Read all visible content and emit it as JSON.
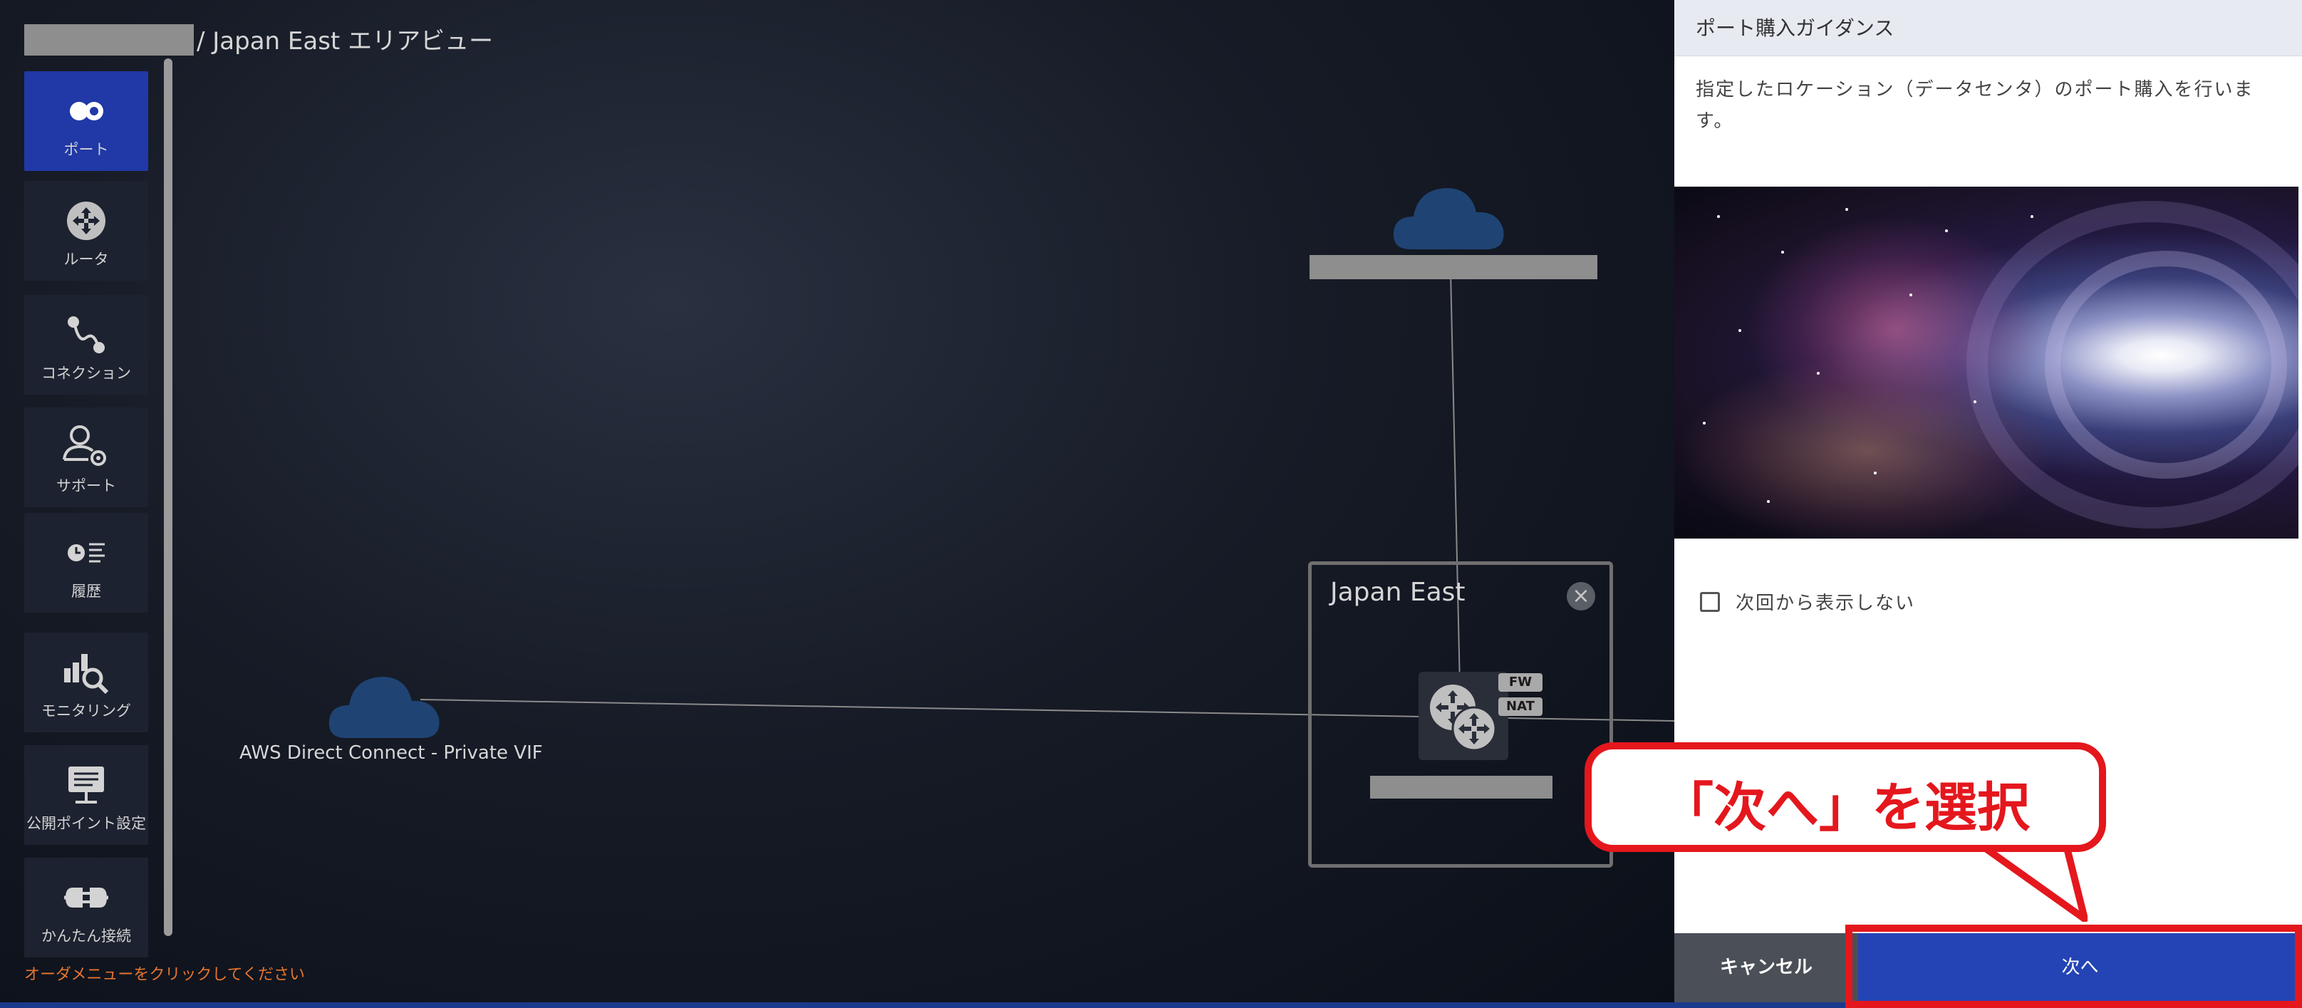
{
  "breadcrumb": {
    "area_label": "/ Japan East エリアビュー"
  },
  "sidebar": {
    "items": [
      {
        "label": "ポート",
        "icon": "port-icon",
        "active": true
      },
      {
        "label": "ルータ",
        "icon": "router-icon",
        "active": false
      },
      {
        "label": "コネクション",
        "icon": "connection-icon",
        "active": false
      },
      {
        "label": "サポート",
        "icon": "support-icon",
        "active": false
      },
      {
        "label": "履歴",
        "icon": "history-icon",
        "active": false
      },
      {
        "label": "モニタリング",
        "icon": "monitoring-icon",
        "active": false
      },
      {
        "label": "公開ポイント設定",
        "icon": "public-point-icon",
        "active": false
      },
      {
        "label": "かんたん接続",
        "icon": "easy-connect-icon",
        "active": false
      }
    ]
  },
  "status": {
    "hint": "オーダメニューをクリックしてください"
  },
  "canvas": {
    "aws_label": "AWS Direct Connect - Private VIF",
    "region_title": "Japan East",
    "close_symbol": "×",
    "tag_fw": "FW",
    "tag_nat": "NAT"
  },
  "panel": {
    "title": "ポート購入ガイダンス",
    "description": "指定したロケーション（データセンタ）のポート購入を行います。",
    "checkbox_label": "次回から表示しない",
    "cancel_label": "キャンセル",
    "next_label": "次へ"
  },
  "annotation": {
    "callout_text": "「次へ」を選択"
  },
  "colors": {
    "accent": "#2444b5",
    "active_menu": "#2039a6",
    "annotation_red": "#e4171d",
    "cloud": "#1f4474",
    "hint_orange": "#e6752f"
  }
}
